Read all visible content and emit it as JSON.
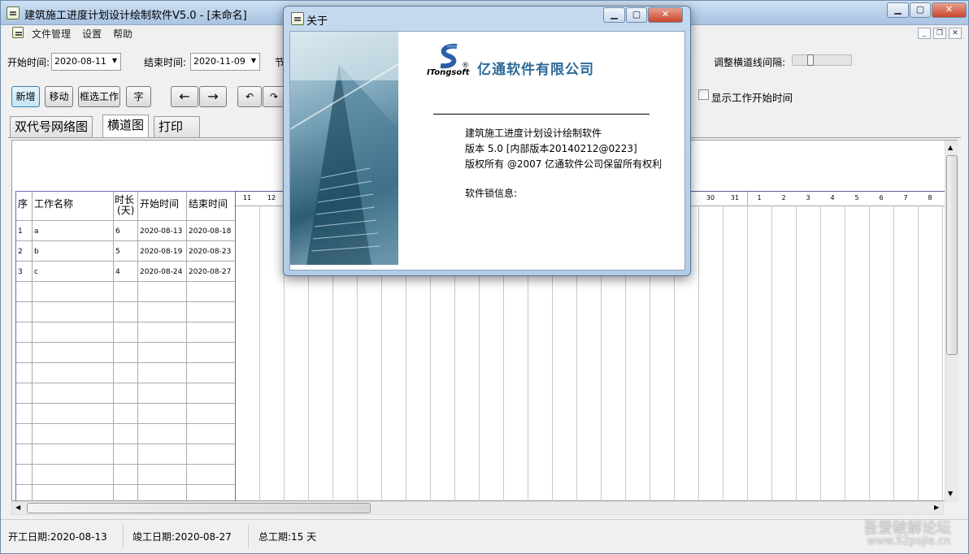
{
  "window": {
    "title": "建筑施工进度计划设计绘制软件V5.0 - [未命名]"
  },
  "menu": [
    "文件管理",
    "设置",
    "帮助"
  ],
  "toolbar": {
    "start_label": "开始时间:",
    "start_value": "2020-08-11",
    "end_label": "结束时间:",
    "end_value": "2020-11-09",
    "partial_label": "节",
    "spacing_label": "调整横道线间隔:",
    "buttons": [
      "新增",
      "移动",
      "框选工作",
      "字"
    ],
    "arrow_left": "←",
    "arrow_right": "→",
    "undo": "↶",
    "redo": "↷",
    "show_start_checkbox": "显示工作开始时间"
  },
  "tabs": [
    "双代号网络图",
    "横道图",
    "打印"
  ],
  "table": {
    "headers": {
      "seq": "序",
      "name": "工作名称",
      "dur_top": "时长",
      "dur_bottom": "(天)",
      "start": "开始时间",
      "end": "结束时间"
    },
    "rows": [
      {
        "seq": "1",
        "name": "a",
        "dur": "6",
        "start": "2020-08-13",
        "end": "2020-08-18"
      },
      {
        "seq": "2",
        "name": "b",
        "dur": "5",
        "start": "2020-08-19",
        "end": "2020-08-23"
      },
      {
        "seq": "3",
        "name": "c",
        "dur": "4",
        "start": "2020-08-24",
        "end": "2020-08-27"
      }
    ]
  },
  "days_left": [
    "11",
    "12"
  ],
  "days_right": [
    "30",
    "31",
    "1",
    "2",
    "3",
    "4",
    "5",
    "6",
    "7",
    "8"
  ],
  "status": {
    "start": "开工日期:2020-08-13",
    "end": "竣工日期:2020-08-27",
    "total": "总工期:15 天"
  },
  "dialog": {
    "title": "关于",
    "logo_text": "ITongsoft",
    "reg_mark": "®",
    "company": "亿通软件有限公司",
    "product": "建筑施工进度计划设计绘制软件",
    "version": "版本  5.0 [内部版本20140212@0223]",
    "copyright": "版权所有 @2007 亿通软件公司保留所有权利",
    "lock_info": "软件锁信息:"
  },
  "watermark": {
    "line1": "吾爱破解论坛",
    "line2": "www.52pojie.cn"
  }
}
